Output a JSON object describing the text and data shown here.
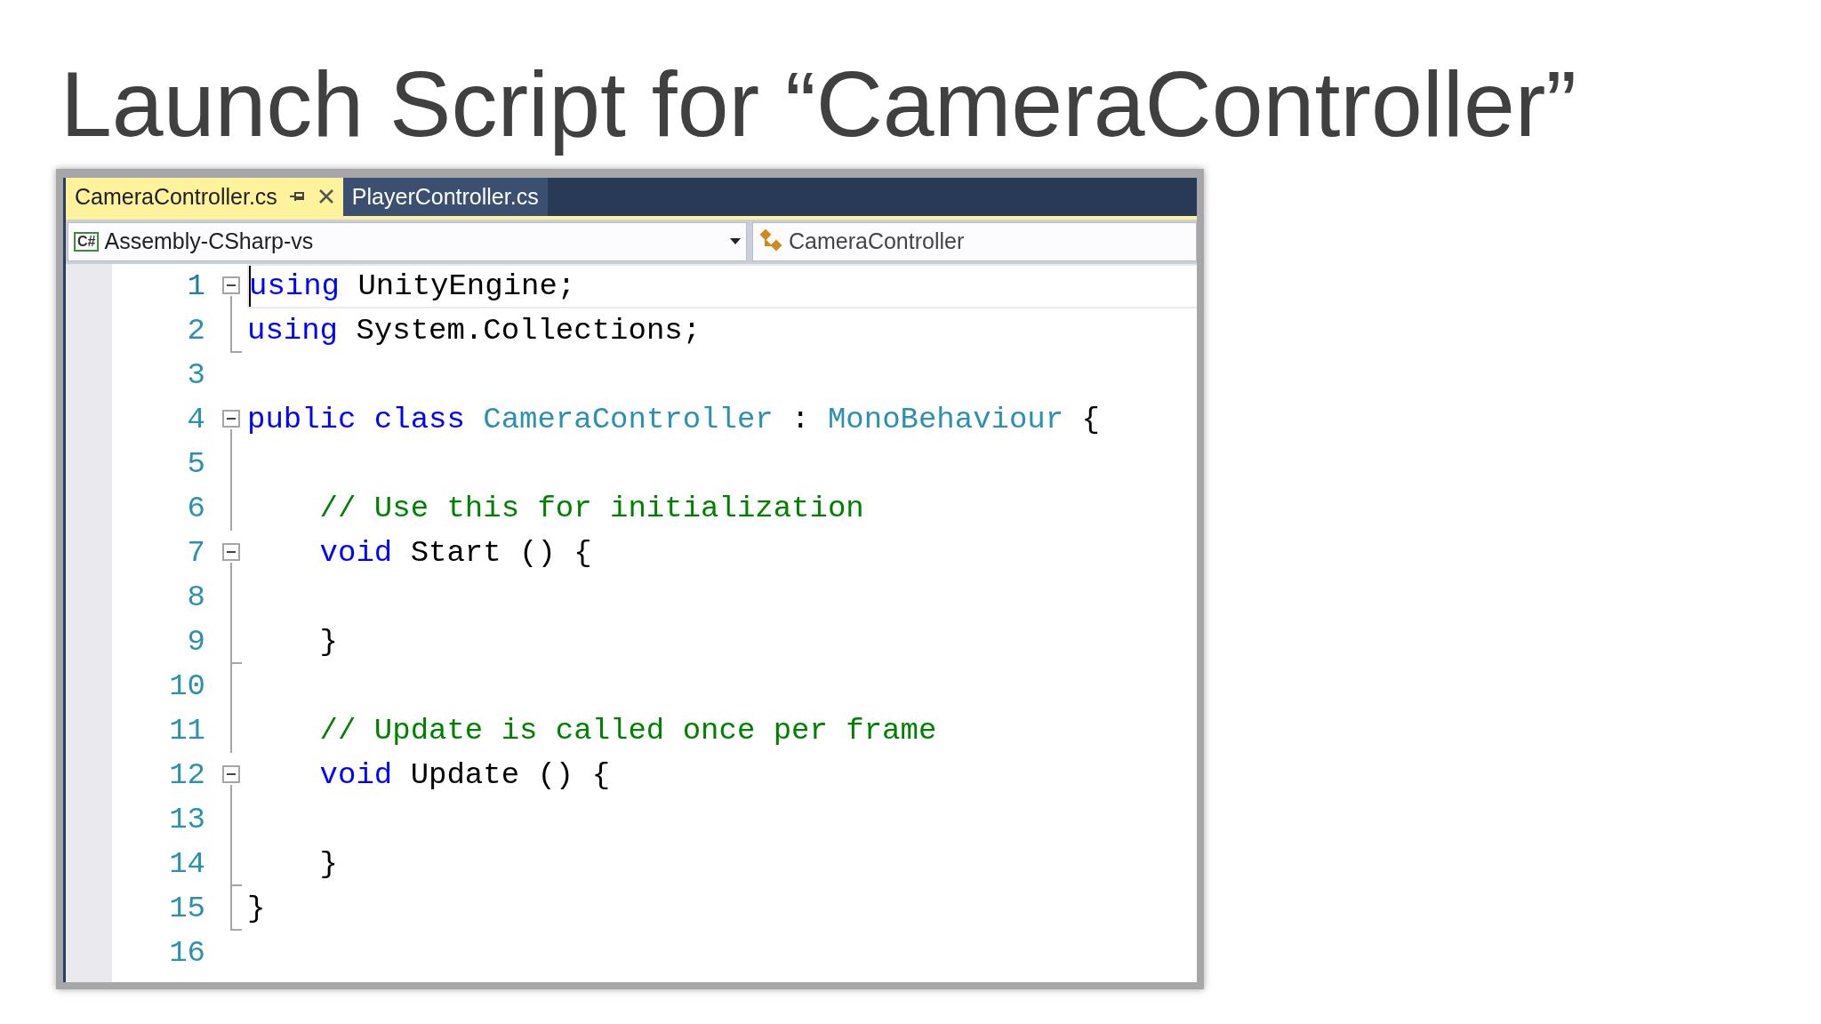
{
  "slide_title": "Launch Script for “CameraController”",
  "editor": {
    "tabs": [
      {
        "label": "CameraController.cs",
        "selected": true
      },
      {
        "label": "PlayerController.cs",
        "selected": false
      }
    ],
    "nav_bar": {
      "project": {
        "icon_text": "C#",
        "label": "Assembly-CSharp-vs"
      },
      "type": {
        "label": "CameraController"
      }
    },
    "lines": [
      {
        "number": "1",
        "fold": {
          "kind": "open"
        },
        "current": true,
        "tokens": [
          {
            "text": "using",
            "kind": "keyword"
          },
          {
            "text": " UnityEngine;",
            "kind": "plain"
          }
        ]
      },
      {
        "number": "2",
        "fold": {
          "kind": "close"
        },
        "current": false,
        "tokens": [
          {
            "text": "using",
            "kind": "keyword"
          },
          {
            "text": " System.Collections;",
            "kind": "plain"
          }
        ]
      },
      {
        "number": "3",
        "current": false
      },
      {
        "number": "4",
        "fold": {
          "kind": "open"
        },
        "current": false,
        "tokens": [
          {
            "text": "public class",
            "kind": "keyword"
          },
          {
            "text": " CameraController",
            "kind": "type"
          },
          {
            "text": " : ",
            "kind": "plain"
          },
          {
            "text": "MonoBehaviour",
            "kind": "type"
          },
          {
            "text": " {",
            "kind": "plain"
          }
        ]
      },
      {
        "number": "5",
        "fold": {
          "kind": "bar"
        },
        "current": false
      },
      {
        "number": "6",
        "fold": {
          "kind": "bar"
        },
        "current": false,
        "tokens": [
          {
            "text": "    // Use this for initialization",
            "kind": "comment"
          }
        ]
      },
      {
        "number": "7",
        "fold": {
          "kind": "open"
        },
        "current": false,
        "tokens": [
          {
            "text": "    void",
            "kind": "keyword"
          },
          {
            "text": " Start () {",
            "kind": "plain"
          }
        ]
      },
      {
        "number": "8",
        "fold": {
          "kind": "bar"
        },
        "current": false
      },
      {
        "number": "9",
        "fold": {
          "kind": "close"
        },
        "current": false,
        "tokens": [
          {
            "text": "    }",
            "kind": "plain"
          }
        ]
      },
      {
        "number": "10",
        "fold": {
          "kind": "bar"
        },
        "current": false
      },
      {
        "number": "11",
        "fold": {
          "kind": "bar"
        },
        "current": false,
        "tokens": [
          {
            "text": "    // Update is called once per frame",
            "kind": "comment"
          }
        ]
      },
      {
        "number": "12",
        "fold": {
          "kind": "open"
        },
        "current": false,
        "tokens": [
          {
            "text": "    void",
            "kind": "keyword"
          },
          {
            "text": " Update () {",
            "kind": "plain"
          }
        ]
      },
      {
        "number": "13",
        "fold": {
          "kind": "bar"
        },
        "current": false
      },
      {
        "number": "14",
        "fold": {
          "kind": "close"
        },
        "current": false,
        "tokens": [
          {
            "text": "    }",
            "kind": "plain"
          }
        ]
      },
      {
        "number": "15",
        "fold": {
          "kind": "close"
        },
        "current": false,
        "tokens": [
          {
            "text": "}",
            "kind": "plain"
          }
        ]
      },
      {
        "number": "16",
        "current": false
      }
    ]
  }
}
